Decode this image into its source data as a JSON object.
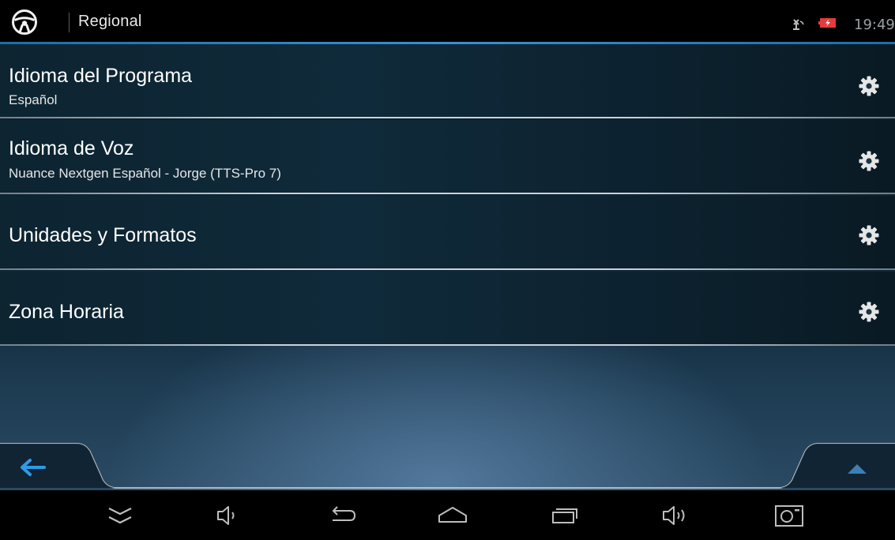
{
  "header": {
    "title": "Regional",
    "time": "19:49",
    "app_icon": "steering-wheel-icon",
    "status_icons": [
      "gps-off-icon",
      "battery-charging-icon"
    ]
  },
  "settings": [
    {
      "label": "Idioma del Programa",
      "value": "Español",
      "icon": "gear-icon"
    },
    {
      "label": "Idioma de Voz",
      "value": "Nuance Nextgen Español - Jorge (TTS-Pro 7)",
      "icon": "gear-icon"
    },
    {
      "label": "Unidades y Formatos",
      "value": "",
      "icon": "gear-icon"
    },
    {
      "label": "Zona Horaria",
      "value": "",
      "icon": "gear-icon"
    }
  ],
  "app_toolbar": {
    "back_icon": "back-arrow-icon",
    "up_icon": "chevron-up-icon"
  },
  "system_nav": [
    "hide-bar-icon",
    "volume-down-icon",
    "back-icon",
    "home-icon",
    "recent-apps-icon",
    "volume-up-icon",
    "screenshot-icon"
  ],
  "colors": {
    "accent": "#3b8fd0",
    "back_arrow": "#2e9be6",
    "topbar": "#000000"
  }
}
